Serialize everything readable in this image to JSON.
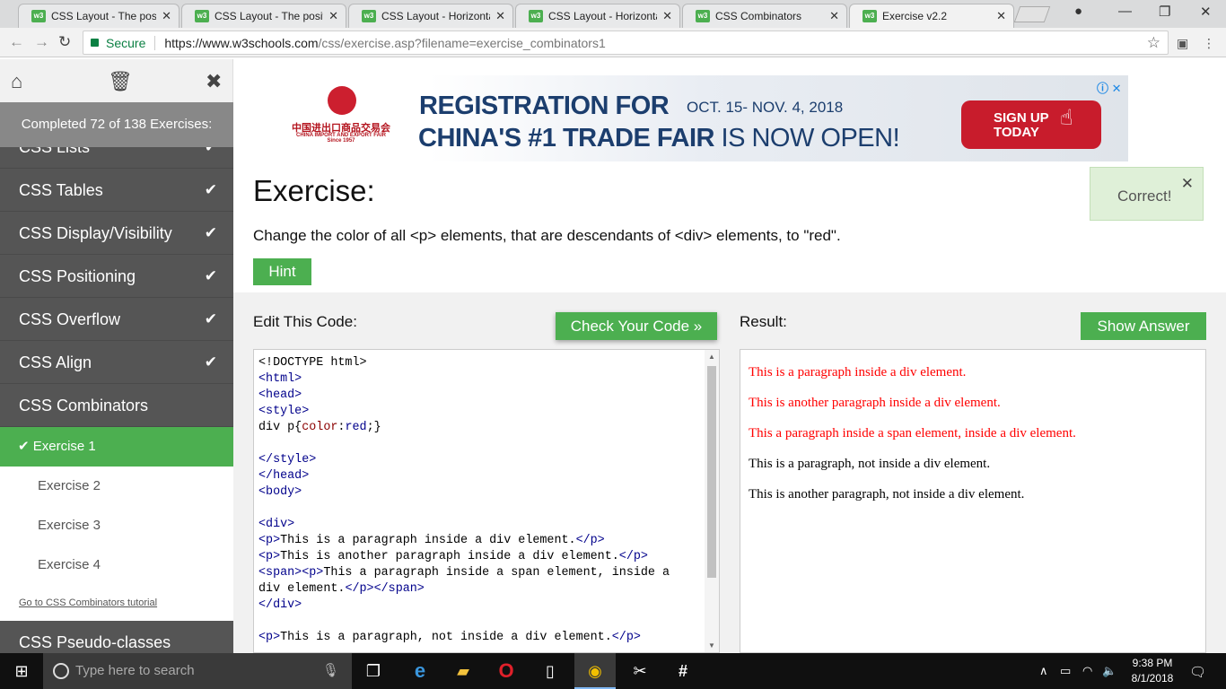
{
  "browser": {
    "tabs": [
      {
        "label": "CSS Layout - The positio"
      },
      {
        "label": "CSS Layout - The positio"
      },
      {
        "label": "CSS Layout - Horizontal"
      },
      {
        "label": "CSS Layout - Horizontal"
      },
      {
        "label": "CSS Combinators"
      },
      {
        "label": "Exercise v2.2"
      }
    ],
    "secure_label": "Secure",
    "url_host": "https://www.w3schools.com",
    "url_path": "/css/exercise.asp?filename=exercise_combinators1"
  },
  "sidebar": {
    "progress_text": "Completed 72 of 138 Exercises:",
    "partial_item": "CSS Lists",
    "items": [
      {
        "label": "CSS Tables",
        "check": "✔"
      },
      {
        "label": "CSS Display/Visibility",
        "check": "✔"
      },
      {
        "label": "CSS Positioning",
        "check": "✔"
      },
      {
        "label": "CSS Overflow",
        "check": "✔"
      },
      {
        "label": "CSS Align",
        "check": "✔"
      }
    ],
    "current_section": "CSS Combinators",
    "exercises": [
      {
        "label": "Exercise 1"
      },
      {
        "label": "Exercise 2"
      },
      {
        "label": "Exercise 3"
      },
      {
        "label": "Exercise 4"
      }
    ],
    "active_check": "✔",
    "tutorial_link": "Go to CSS Combinators tutorial",
    "next_section": "CSS Pseudo-classes"
  },
  "ad": {
    "org_name_cn": "中国进出口商品交易会",
    "org_name_en": "CHINA IMPORT AND EXPORT FAIR",
    "org_since": "Since 1957",
    "headline_1": "REGISTRATION FOR",
    "dates": "OCT. 15- NOV. 4, 2018",
    "headline_2_bold": "CHINA'S #1 TRADE FAIR",
    "headline_2_rest": " IS NOW OPEN!",
    "cta_line1": "SIGN UP",
    "cta_line2": "TODAY"
  },
  "exercise": {
    "title": "Exercise:",
    "prompt": "Change the color of all <p> elements, that are descendants of <div> elements, to \"red\".",
    "hint_label": "Hint",
    "correct_text": "Correct!",
    "edit_label": "Edit This Code:",
    "check_label": "Check Your Code »",
    "result_label": "Result:",
    "answer_label": "Show Answer"
  },
  "code_lines": [
    "<!DOCTYPE html>",
    "<html>",
    "<head>",
    "<style>",
    "div p{color:red;}",
    "",
    "</style>",
    "</head>",
    "<body>",
    "",
    "<div>",
    "<p>This is a paragraph inside a div element.</p>",
    "<p>This is another paragraph inside a div element.</p>",
    "<span><p>This a paragraph inside a span element, inside a div element.</p></span>",
    "</div>",
    "",
    "<p>This is a paragraph, not inside a div element.</p>"
  ],
  "result": {
    "paragraphs": [
      {
        "text": "This is a paragraph inside a div element.",
        "color": "#ff0000"
      },
      {
        "text": "This is another paragraph inside a div element.",
        "color": "#ff0000"
      },
      {
        "text": "This a paragraph inside a span element, inside a div element.",
        "color": "#ff0000"
      },
      {
        "text": "This is a paragraph, not inside a div element.",
        "color": "#000000"
      },
      {
        "text": "This is another paragraph, not inside a div element.",
        "color": "#000000"
      }
    ]
  },
  "taskbar": {
    "search_placeholder": "Type here to search",
    "time": "9:38 PM",
    "date": "8/1/2018"
  },
  "colors": {
    "accent": "#4caf50",
    "sidebar_bg": "#555555",
    "correct_bg": "#dff0d8"
  }
}
